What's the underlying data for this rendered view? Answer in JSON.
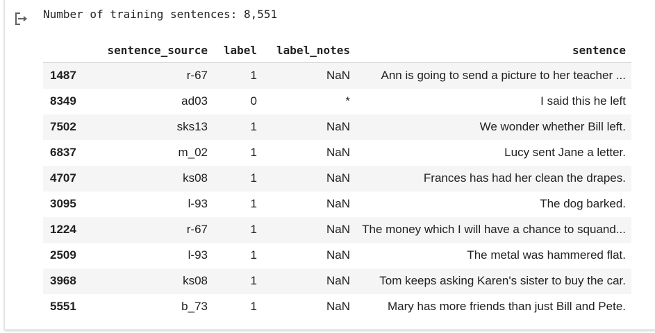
{
  "output": {
    "icon": "output-redirect-icon",
    "stdout_text": "Number of training sentences: 8,551"
  },
  "table": {
    "columns": [
      "",
      "sentence_source",
      "label",
      "label_notes",
      "sentence"
    ],
    "rows": [
      {
        "index": "1487",
        "sentence_source": "r-67",
        "label": "1",
        "label_notes": "NaN",
        "sentence": "Ann is going to send a picture to her teacher ..."
      },
      {
        "index": "8349",
        "sentence_source": "ad03",
        "label": "0",
        "label_notes": "*",
        "sentence": "I said this he left"
      },
      {
        "index": "7502",
        "sentence_source": "sks13",
        "label": "1",
        "label_notes": "NaN",
        "sentence": "We wonder whether Bill left."
      },
      {
        "index": "6837",
        "sentence_source": "m_02",
        "label": "1",
        "label_notes": "NaN",
        "sentence": "Lucy sent Jane a letter."
      },
      {
        "index": "4707",
        "sentence_source": "ks08",
        "label": "1",
        "label_notes": "NaN",
        "sentence": "Frances has had her clean the drapes."
      },
      {
        "index": "3095",
        "sentence_source": "l-93",
        "label": "1",
        "label_notes": "NaN",
        "sentence": "The dog barked."
      },
      {
        "index": "1224",
        "sentence_source": "r-67",
        "label": "1",
        "label_notes": "NaN",
        "sentence": "The money which I will have a chance to squand..."
      },
      {
        "index": "2509",
        "sentence_source": "l-93",
        "label": "1",
        "label_notes": "NaN",
        "sentence": "The metal was hammered flat."
      },
      {
        "index": "3968",
        "sentence_source": "ks08",
        "label": "1",
        "label_notes": "NaN",
        "sentence": "Tom keeps asking Karen's sister to buy the car."
      },
      {
        "index": "5551",
        "sentence_source": "b_73",
        "label": "1",
        "label_notes": "NaN",
        "sentence": "Mary has more friends than just Bill and Pete."
      }
    ]
  }
}
